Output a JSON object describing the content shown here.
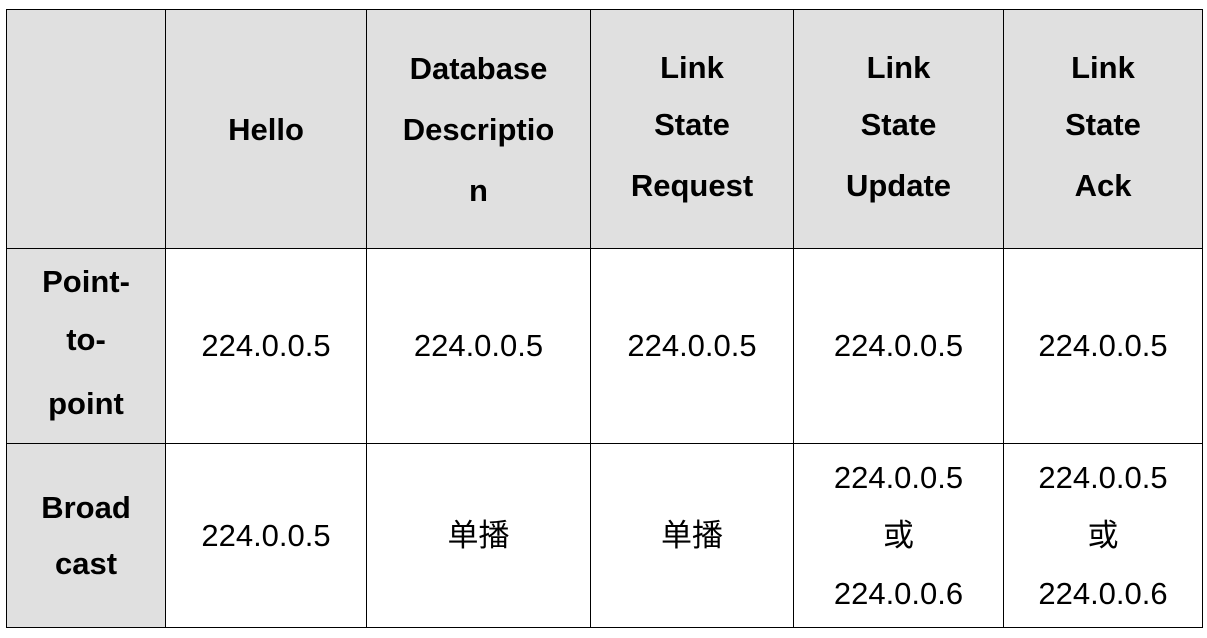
{
  "columns": [
    "",
    "Hello",
    "Database Description",
    "Link State Request",
    "Link State Update",
    "Link State Ack"
  ],
  "header_lines": [
    [],
    [
      "Hello"
    ],
    [
      "Database",
      "Descriptio",
      "n"
    ],
    [
      "Link",
      "State",
      "Request"
    ],
    [
      "Link",
      "State",
      "Update"
    ],
    [
      "Link",
      "State",
      "Ack"
    ]
  ],
  "rows": [
    {
      "label_lines": [
        "Point-",
        "to-",
        "point"
      ],
      "cells": [
        [
          "224.0.0.5"
        ],
        [
          "224.0.0.5"
        ],
        [
          "224.0.0.5"
        ],
        [
          "224.0.0.5"
        ],
        [
          "224.0.0.5"
        ]
      ]
    },
    {
      "label_lines": [
        "Broad",
        "cast"
      ],
      "cells": [
        [
          "224.0.0.5"
        ],
        [
          "单播"
        ],
        [
          "单播"
        ],
        [
          "224.0.0.5",
          "或",
          "224.0.0.6"
        ],
        [
          "224.0.0.5",
          "或",
          "224.0.0.6"
        ]
      ]
    }
  ],
  "colors": {
    "header_background": "#e0e0e0",
    "cell_background": "#ffffff",
    "border": "#000000"
  }
}
